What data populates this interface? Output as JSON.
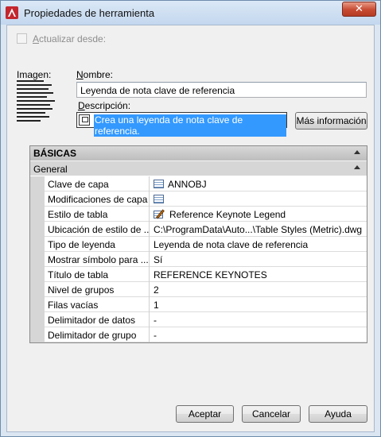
{
  "window": {
    "title": "Propiedades de herramienta",
    "close_glyph": "✕",
    "app_icon": "autocad-icon"
  },
  "update_from": {
    "label": "Actualizar desde:",
    "checked": false
  },
  "image_label": "Imagen:",
  "name": {
    "label": "Nombre:",
    "value": "Leyenda de nota clave de referencia"
  },
  "description": {
    "label": "Descripción:",
    "value": "Crea una leyenda de nota clave de referencia.",
    "icon": "copy-icon"
  },
  "more_info_button": "Más información",
  "properties": {
    "category": "BÁSICAS",
    "group": "General",
    "rows": [
      {
        "name": "Clave de capa",
        "value": "ANNOBJ",
        "icon": "table-icon"
      },
      {
        "name": "Modificaciones de capa",
        "value": "",
        "icon": "table-icon"
      },
      {
        "name": "Estilo de tabla",
        "value": "Reference Keynote Legend",
        "icon": "table-style-icon"
      },
      {
        "name": "Ubicación de estilo de ...",
        "value": "C:\\ProgramData\\Auto...\\Table Styles (Metric).dwg",
        "icon": ""
      },
      {
        "name": "Tipo de leyenda",
        "value": "Leyenda de nota clave de referencia",
        "icon": ""
      },
      {
        "name": "Mostrar símbolo para ...",
        "value": "Sí",
        "icon": ""
      },
      {
        "name": "Título de tabla",
        "value": "REFERENCE KEYNOTES",
        "icon": ""
      },
      {
        "name": "Nivel de grupos",
        "value": "2",
        "icon": ""
      },
      {
        "name": "Filas vacías",
        "value": "1",
        "icon": ""
      },
      {
        "name": "Delimitador de datos",
        "value": "-",
        "icon": ""
      },
      {
        "name": "Delimitador de grupo",
        "value": "-",
        "icon": ""
      }
    ]
  },
  "buttons": {
    "ok": "Aceptar",
    "cancel": "Cancelar",
    "help": "Ayuda"
  }
}
